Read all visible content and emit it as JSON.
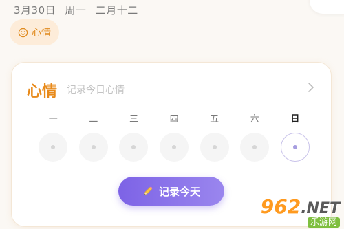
{
  "header": {
    "date": "3月30日",
    "weekday": "周一",
    "lunar": "二月十二"
  },
  "mood_chip": {
    "label": "心情",
    "icon": "smile-icon"
  },
  "card": {
    "title": "心情",
    "subtitle": "记录今日心情",
    "chevron_icon": "chevron-right-icon",
    "days": [
      {
        "label": "一",
        "active": false
      },
      {
        "label": "二",
        "active": false
      },
      {
        "label": "三",
        "active": false
      },
      {
        "label": "四",
        "active": false
      },
      {
        "label": "五",
        "active": false
      },
      {
        "label": "六",
        "active": false
      },
      {
        "label": "日",
        "active": true
      }
    ],
    "record_button": {
      "label": "记录今天",
      "icon": "pencil-icon"
    }
  },
  "watermark": {
    "number": "962",
    "suffix": ".NET",
    "site": "乐游网"
  },
  "colors": {
    "accent_orange": "#e88a1a",
    "button_purple": "#7d63e6",
    "active_ring": "#c9c3ea"
  }
}
